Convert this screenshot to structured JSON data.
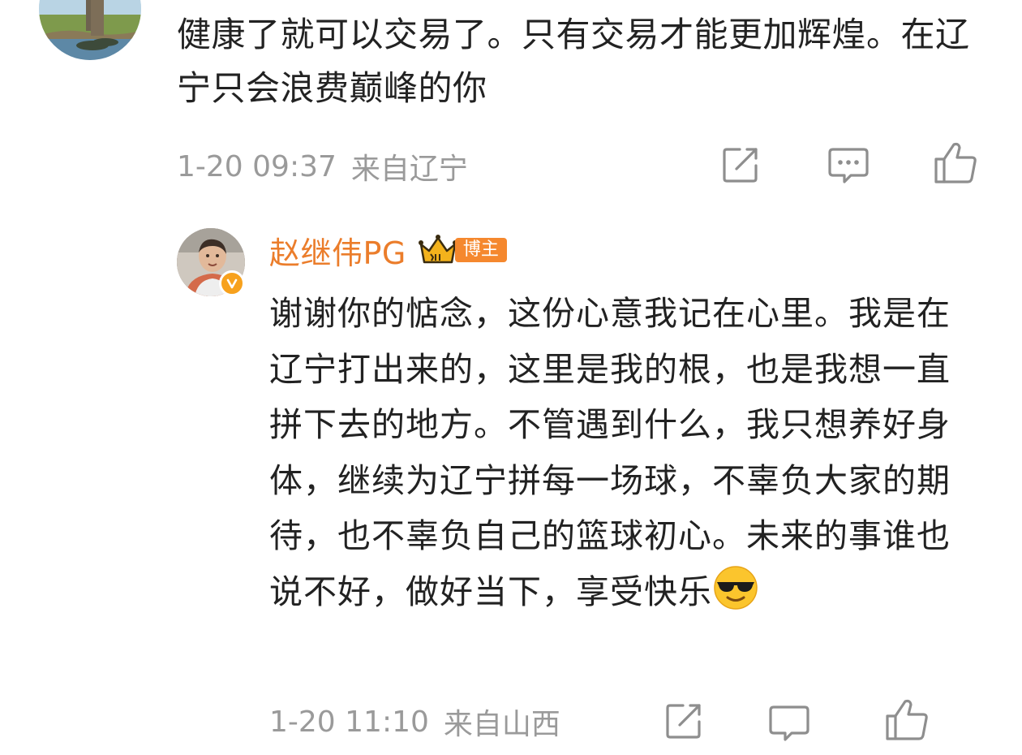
{
  "top_comment": {
    "text": "健康了就可以交易了。只有交易才能更加辉煌。在辽宁只会浪费巅峰的你",
    "time": "1-20 09:37",
    "location": "来自辽宁",
    "icons": [
      "share-icon",
      "comment-icon",
      "like-icon"
    ]
  },
  "reply": {
    "author": "赵继伟PG",
    "role_badge": "博主",
    "text": "谢谢你的惦念，这份心意我记在心里。我是在辽宁打出来的，这里是我的根，也是我想一直拼下去的地方。不管遇到什么，我只想养好身体，继续为辽宁拼每一场球，不辜负大家的期待，也不辜负自己的篮球初心。未来的事谁也说不好，做好当下，享受快乐",
    "emoji": "sunglasses-emoji",
    "time": "1-20 11:10",
    "location": "来自山西",
    "icons": [
      "share-icon",
      "comment-icon",
      "like-icon"
    ]
  },
  "colors": {
    "author_name": "#eb7d2b",
    "badge_bg": "#f5882e",
    "meta_text": "#9a9a9a",
    "body_text": "#222222"
  }
}
